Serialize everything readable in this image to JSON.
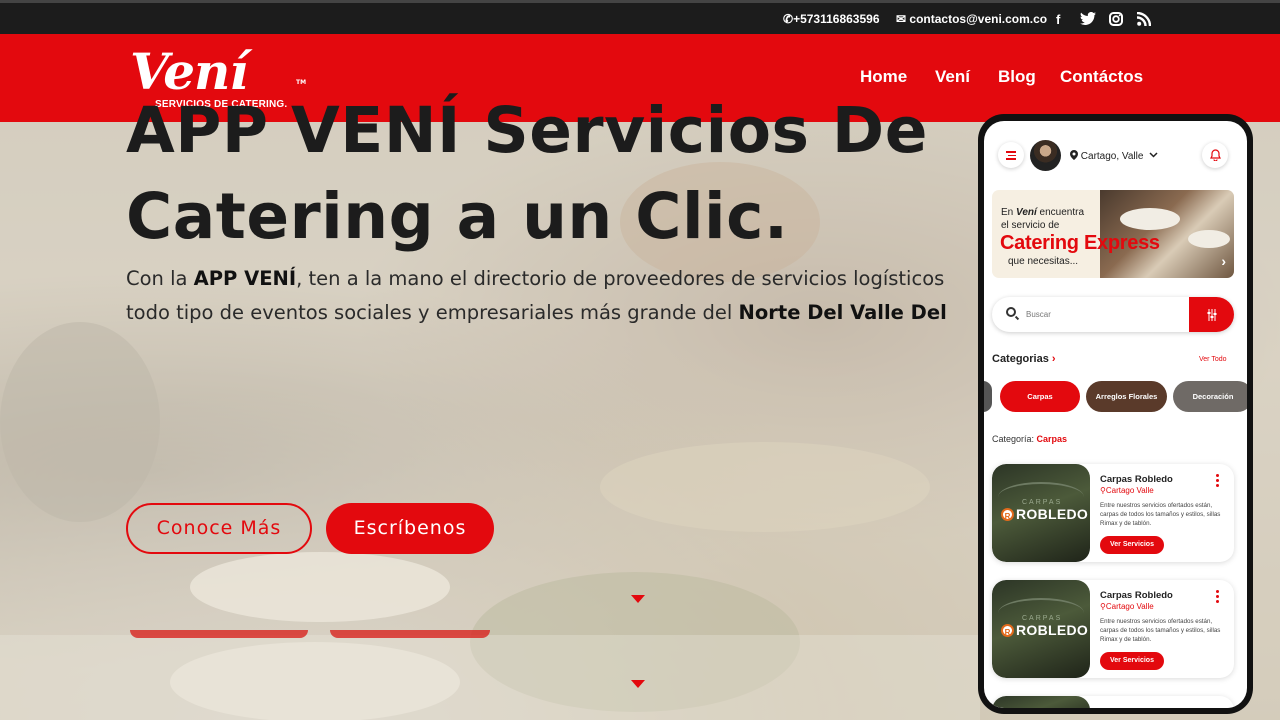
{
  "topbar": {
    "phone": "+573116863596",
    "email": "contactos@veni.com.co",
    "social_icons": [
      "facebook-icon",
      "twitter-icon",
      "instagram-icon",
      "rss-icon"
    ],
    "facebook": "f",
    "rss": "⦿"
  },
  "brand": {
    "logo_text": "Vení",
    "tagline": "SERVICIOS DE CATERING.",
    "trademark": "TM",
    "primary_color": "#e3090e"
  },
  "nav": {
    "items": [
      {
        "label": "Home"
      },
      {
        "label": "Vení"
      },
      {
        "label": "Blog"
      },
      {
        "label": "Contáctos"
      }
    ]
  },
  "hero": {
    "title_line1": "APP VENÍ Servicios De",
    "title_line2": "Catering a un Clic.",
    "text_p1": "Con la ",
    "text_b1": "APP VENÍ",
    "text_p2": ", ten a la mano el directorio de proveedores de servicios logísticos",
    "text_p3": "todo tipo de eventos sociales y empresariales más grande del ",
    "text_b2": "Norte Del Valle Del",
    "btn_more": "Conoce Más",
    "btn_write": "Escríbenos"
  },
  "phone_app": {
    "location": "Cartago, Valle",
    "banner": {
      "line1_pre": "En ",
      "line1_brand": "Vení",
      "line1_post": " encuentra",
      "line2": "el servicio de",
      "headline": "Catering Express",
      "line3": "que necesitas..."
    },
    "search_placeholder": "Buscar",
    "categories_title": "Categorias",
    "see_all": "Ver Todo",
    "categories": [
      {
        "label": "Carpas",
        "color": "#e3090e"
      },
      {
        "label": "Arreglos Florales",
        "color": "#5a3a2a"
      },
      {
        "label": "Decoración",
        "color": "#6f6a66"
      }
    ],
    "selected_category_label": "Categoría:",
    "selected_category": "Carpas",
    "providers": [
      {
        "name": "Carpas Robledo",
        "city": "Cartago Valle",
        "description": "Entre nuestros servicios ofertados están, carpas de todos los tamaños y estilos, sillas Rimax y de tablón.",
        "button": "Ver Servicios",
        "image_small": "CARPAS",
        "image_big": "ROBLEDO",
        "image_mark": "R"
      },
      {
        "name": "Carpas Robledo",
        "city": "Cartago Valle",
        "description": "Entre nuestros servicios ofertados están, carpas de todos los tamaños y estilos, sillas Rimax y de tablón.",
        "button": "Ver Servicios",
        "image_small": "CARPAS",
        "image_big": "ROBLEDO",
        "image_mark": "R"
      }
    ]
  }
}
